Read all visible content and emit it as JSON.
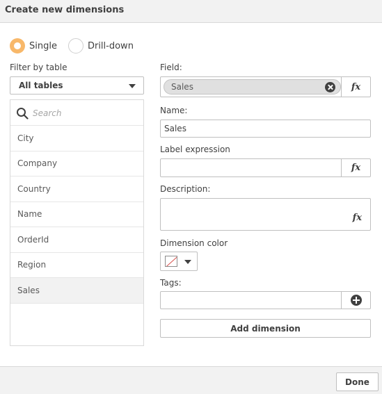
{
  "dialog": {
    "title": "Create new dimensions"
  },
  "mode": {
    "single_label": "Single",
    "drilldown_label": "Drill-down",
    "selected": "Single"
  },
  "filter": {
    "label": "Filter by table",
    "selected": "All tables"
  },
  "search": {
    "placeholder": "Search"
  },
  "fields": {
    "items": [
      {
        "label": "City"
      },
      {
        "label": "Company"
      },
      {
        "label": "Country"
      },
      {
        "label": "Name"
      },
      {
        "label": "OrderId"
      },
      {
        "label": "Region"
      },
      {
        "label": "Sales"
      }
    ],
    "selected": "Sales"
  },
  "form": {
    "field_label": "Field:",
    "field_value": "Sales",
    "name_label": "Name:",
    "name_value": "Sales",
    "label_expression_label": "Label expression",
    "label_expression_value": "",
    "description_label": "Description:",
    "description_value": "",
    "color_label": "Dimension color",
    "tags_label": "Tags:",
    "tags_value": "",
    "fx_symbol": "fx",
    "add_button": "Add dimension"
  },
  "footer": {
    "done_button": "Done"
  },
  "colors": {
    "accent": "#f8b86a",
    "header_bg": "#f2f2f2",
    "border": "#bfbfbf"
  }
}
